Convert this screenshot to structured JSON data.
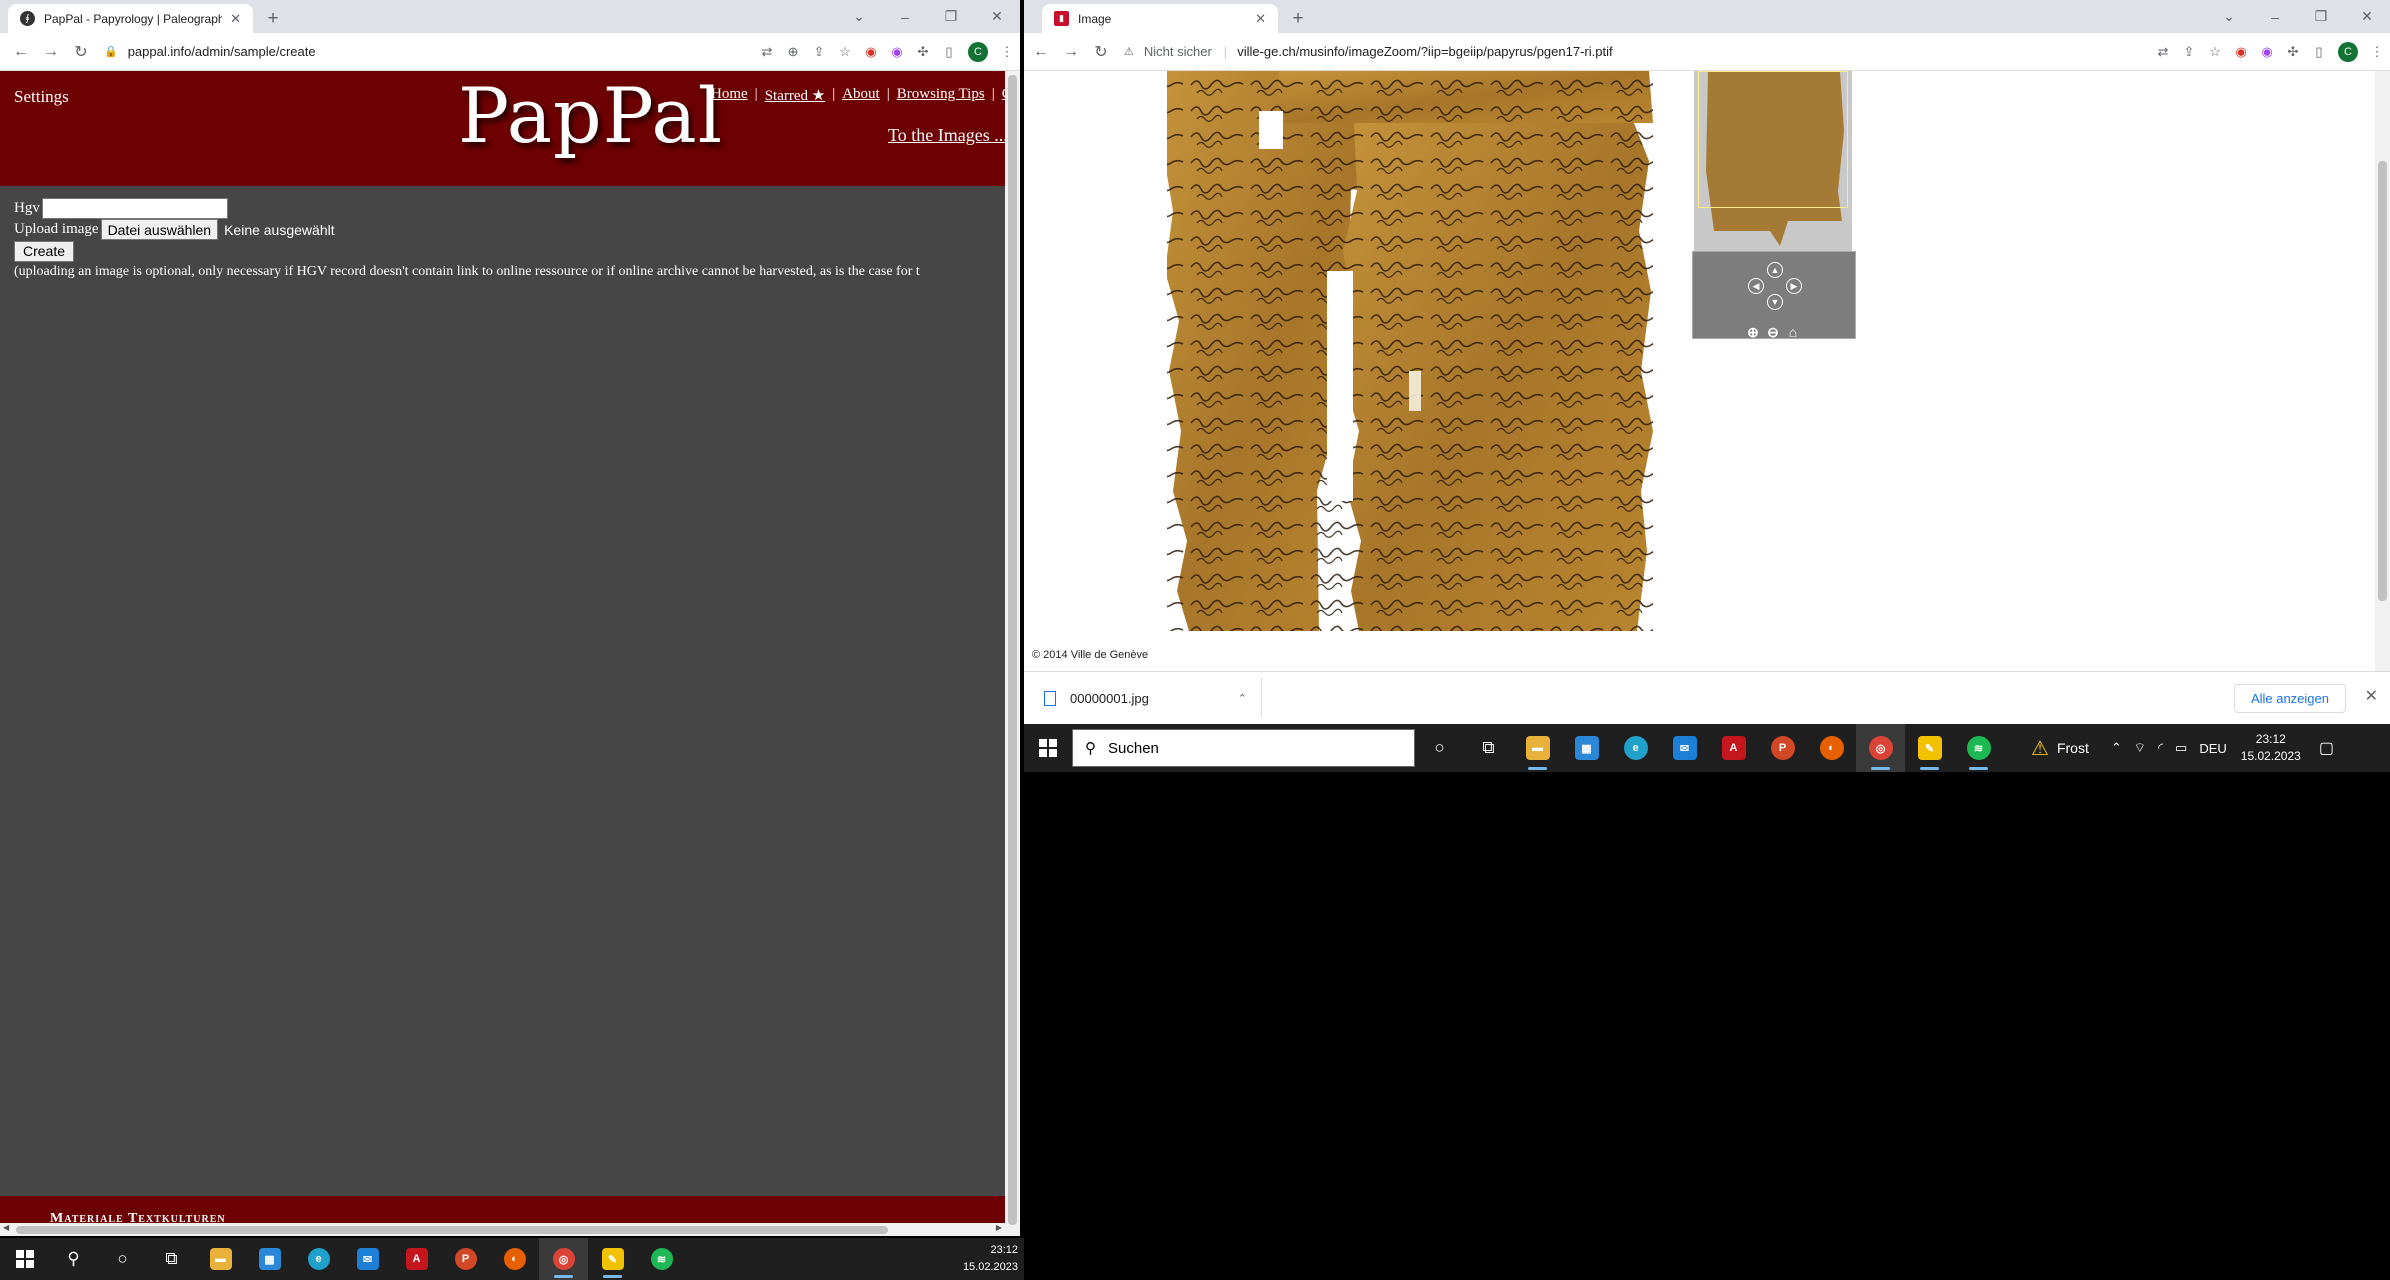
{
  "left_browser": {
    "tab_title": "PapPal - Papyrology | Paleograph",
    "url": "pappal.info/admin/sample/create",
    "profile_initial": "C"
  },
  "pappal": {
    "settings": "Settings",
    "logo": "PapPal",
    "nav": [
      "Home",
      "Starred ★",
      "About",
      "Browsing Tips",
      "C"
    ],
    "to_images": "To the Images ...",
    "hgv_label": "Hgv",
    "upload_label": "Upload image",
    "file_button": "Datei auswählen",
    "no_file": "Keine ausgewählt",
    "create_button": "Create",
    "note": "(uploading an image is optional, only necessary if HGV record doesn't contain link to online ressource or if online archive cannot be harvested, as is the case for t",
    "footer": "Materiale Textkulturen"
  },
  "left_taskbar": {
    "time": "23:12",
    "date": "15.02.2023"
  },
  "right_browser": {
    "tab_title": "Image",
    "insecure_label": "Nicht sicher",
    "url": "ville-ge.ch/musinfo/imageZoom/?iip=bgeiip/papyrus/pgen17-ri.ptif",
    "profile_initial": "C",
    "copyright": "© 2014 Ville de Genève",
    "download_file": "00000001.jpg",
    "show_all": "Alle anzeigen"
  },
  "right_taskbar": {
    "search_placeholder": "Suchen",
    "weather": "Frost",
    "language": "DEU",
    "time": "23:12",
    "date": "15.02.2023"
  },
  "colors": {
    "pappal_red": "#6d0002",
    "page_gray": "#464646",
    "papyrus": "#b8862f"
  }
}
